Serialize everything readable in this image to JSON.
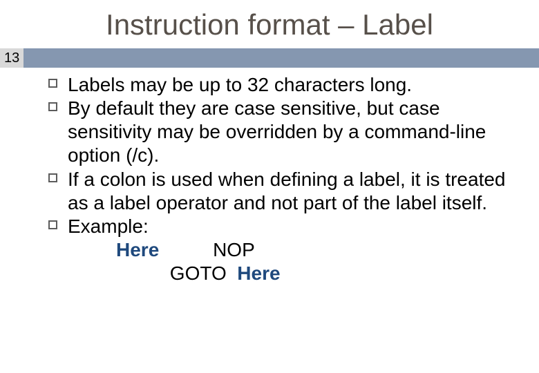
{
  "title": "Instruction format – Label",
  "slide_number": "13",
  "bullets": [
    "Labels may be up to 32 characters long.",
    "By default they are case sensitive, but case sensitivity may be overridden by a command-line option (/c).",
    "If a colon is used when defining a label, it is treated as a label operator and not part of the label itself.",
    "Example:"
  ],
  "example": {
    "row1": {
      "label": "Here",
      "gap1": "          ",
      "op": "NOP"
    },
    "row2": {
      "pad": "          ",
      "op": "GOTO",
      "gap2": "  ",
      "target": "Here"
    }
  }
}
